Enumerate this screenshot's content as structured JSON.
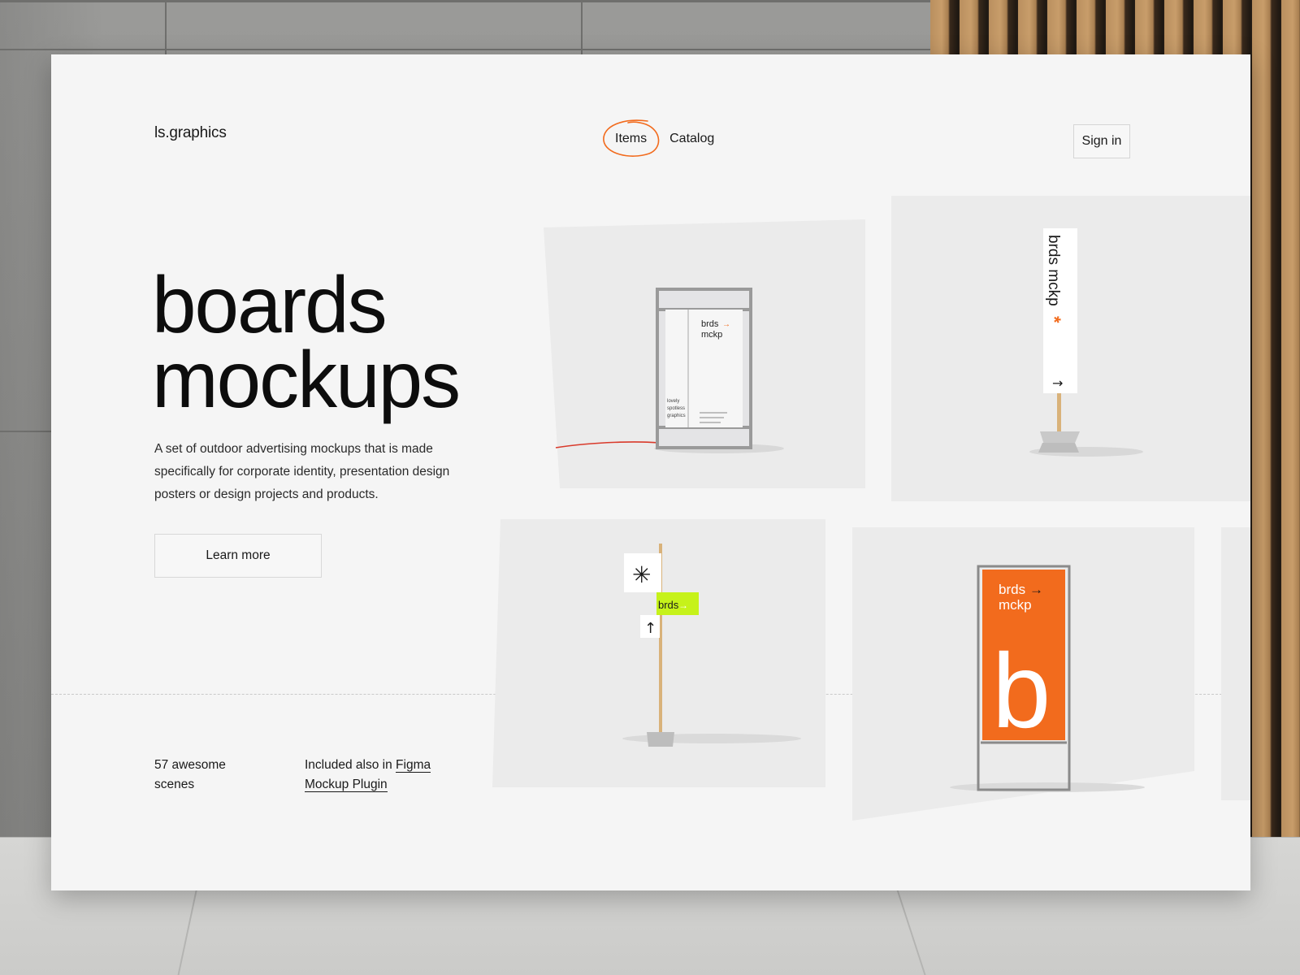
{
  "site": {
    "logo": "ls.graphics"
  },
  "nav": {
    "items": [
      {
        "label": "Items",
        "active": true
      },
      {
        "label": "Catalog",
        "active": false
      }
    ],
    "signin_label": "Sign in"
  },
  "hero": {
    "title_line1": "boards",
    "title_line2": "mockups",
    "description": "A set of outdoor advertising mockups that is made specifically for corporate identity, presentation design posters or design projects and products.",
    "learn_more_label": "Learn more"
  },
  "stats": {
    "scenes_line1": "57 awesome",
    "scenes_line2": "scenes",
    "included_prefix": "Included also in ",
    "figma_link_line1": "Figma",
    "figma_link_line2": "Mockup Plugin"
  },
  "tiles": {
    "lightbox": {
      "brand_line1": "brds",
      "brand_line2": "mckp",
      "side_line1": "lovely",
      "side_line2": "spotless",
      "side_line3": "graphics"
    },
    "flag": {
      "vertical_text": "brds mckp"
    },
    "signpost": {
      "sign_text": "brds"
    },
    "banner": {
      "brand_line1": "brds",
      "brand_line2": "mckp",
      "big_letter": "b"
    }
  },
  "colors": {
    "accent": "#f26b1d",
    "lime": "#c6f21a",
    "card_bg": "#f5f5f5",
    "tile_bg": "#ebebeb",
    "text": "#1a1a1a"
  }
}
